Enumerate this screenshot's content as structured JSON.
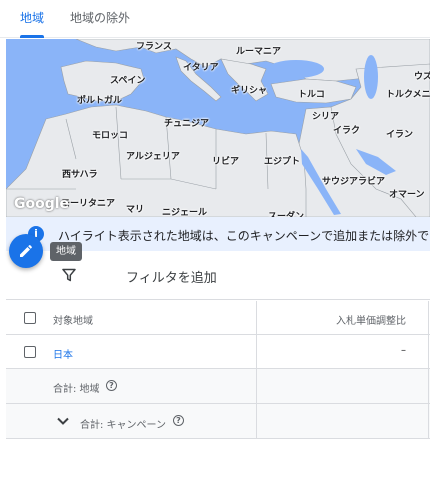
{
  "tabs": [
    {
      "label": "地域",
      "active": true
    },
    {
      "label": "地域の除外",
      "active": false
    }
  ],
  "map": {
    "labels": [
      "フランス",
      "ルーマニア",
      "ウズ",
      "イタリア",
      "スペイン",
      "ポルトガル",
      "ギリシャ",
      "トルコ",
      "トルクメニ",
      "チュニジア",
      "シリア",
      "モロッコ",
      "イラク",
      "イラン",
      "アルジェリア",
      "リビア",
      "エジプト",
      "西サハラ",
      "サウジアラビア",
      "モーリタニア",
      "マリ",
      "ニジェール",
      "オマーン",
      "スーダン"
    ],
    "logo": "Google",
    "colors": {
      "water": "#8ab4f8",
      "land": "#e8eaed"
    }
  },
  "banner": {
    "text": "ハイライト表示された地域は、このキャンペーンで追加または除外で",
    "icon": "info-icon"
  },
  "fab": {
    "icon": "pencil-icon",
    "tooltip": "地域"
  },
  "filter": {
    "icon": "filter-icon",
    "label": "フィルタを追加"
  },
  "table": {
    "headers": {
      "target": "対象地域",
      "bid": "入札単価調整比"
    },
    "rows": [
      {
        "name": "日本",
        "bid": "–"
      }
    ],
    "totals": {
      "location": "合計: 地域",
      "campaign": "合計: キャンペーン"
    }
  },
  "colors": {
    "accent": "#1a73e8",
    "banner_bg": "#e8f0fe"
  }
}
